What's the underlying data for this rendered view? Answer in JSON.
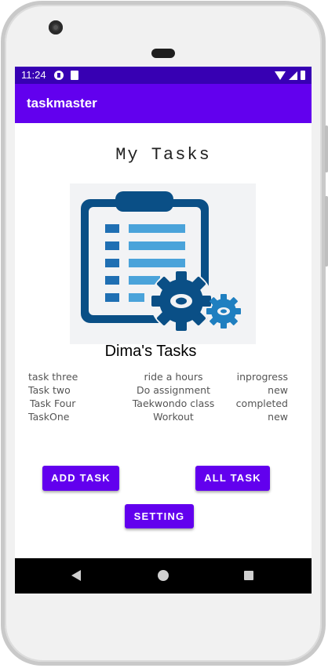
{
  "status_bar": {
    "time": "11:24"
  },
  "app_bar": {
    "title": "taskmaster"
  },
  "main": {
    "page_title": "My Tasks",
    "image_icon": "clipboard-gears-icon",
    "user_tasks_title": "Dima's Tasks",
    "tasks": [
      {
        "title": "task three",
        "body": "ride a hours",
        "state": "inprogress"
      },
      {
        "title": "Task two",
        "body": "Do assignment",
        "state": "new"
      },
      {
        "title": "Task Four",
        "body": "Taekwondo class",
        "state": "completed"
      },
      {
        "title": "TaskOne",
        "body": "Workout",
        "state": "new"
      }
    ],
    "buttons": {
      "add_task": "ADD TASK",
      "all_task": "ALL TASK",
      "setting": "SETTING"
    }
  },
  "colors": {
    "status_bar": "#3700b3",
    "app_bar": "#6200ee",
    "button": "#6200ee",
    "icon_dark": "#0a4f86",
    "icon_light": "#4aa3da"
  }
}
